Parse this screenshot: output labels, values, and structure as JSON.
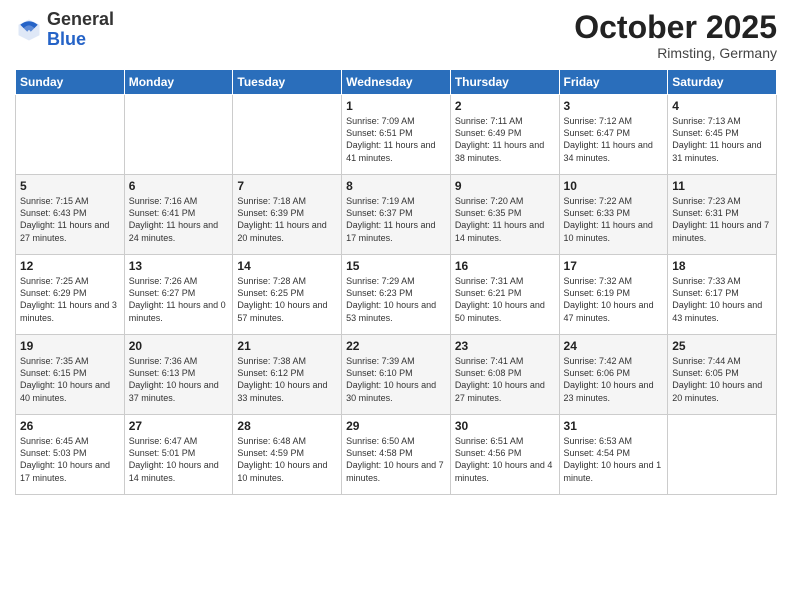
{
  "header": {
    "logo_general": "General",
    "logo_blue": "Blue",
    "month": "October 2025",
    "location": "Rimsting, Germany"
  },
  "days_of_week": [
    "Sunday",
    "Monday",
    "Tuesday",
    "Wednesday",
    "Thursday",
    "Friday",
    "Saturday"
  ],
  "weeks": [
    [
      {
        "day": "",
        "info": ""
      },
      {
        "day": "",
        "info": ""
      },
      {
        "day": "",
        "info": ""
      },
      {
        "day": "1",
        "info": "Sunrise: 7:09 AM\nSunset: 6:51 PM\nDaylight: 11 hours\nand 41 minutes."
      },
      {
        "day": "2",
        "info": "Sunrise: 7:11 AM\nSunset: 6:49 PM\nDaylight: 11 hours\nand 38 minutes."
      },
      {
        "day": "3",
        "info": "Sunrise: 7:12 AM\nSunset: 6:47 PM\nDaylight: 11 hours\nand 34 minutes."
      },
      {
        "day": "4",
        "info": "Sunrise: 7:13 AM\nSunset: 6:45 PM\nDaylight: 11 hours\nand 31 minutes."
      }
    ],
    [
      {
        "day": "5",
        "info": "Sunrise: 7:15 AM\nSunset: 6:43 PM\nDaylight: 11 hours\nand 27 minutes."
      },
      {
        "day": "6",
        "info": "Sunrise: 7:16 AM\nSunset: 6:41 PM\nDaylight: 11 hours\nand 24 minutes."
      },
      {
        "day": "7",
        "info": "Sunrise: 7:18 AM\nSunset: 6:39 PM\nDaylight: 11 hours\nand 20 minutes."
      },
      {
        "day": "8",
        "info": "Sunrise: 7:19 AM\nSunset: 6:37 PM\nDaylight: 11 hours\nand 17 minutes."
      },
      {
        "day": "9",
        "info": "Sunrise: 7:20 AM\nSunset: 6:35 PM\nDaylight: 11 hours\nand 14 minutes."
      },
      {
        "day": "10",
        "info": "Sunrise: 7:22 AM\nSunset: 6:33 PM\nDaylight: 11 hours\nand 10 minutes."
      },
      {
        "day": "11",
        "info": "Sunrise: 7:23 AM\nSunset: 6:31 PM\nDaylight: 11 hours\nand 7 minutes."
      }
    ],
    [
      {
        "day": "12",
        "info": "Sunrise: 7:25 AM\nSunset: 6:29 PM\nDaylight: 11 hours\nand 3 minutes."
      },
      {
        "day": "13",
        "info": "Sunrise: 7:26 AM\nSunset: 6:27 PM\nDaylight: 11 hours\nand 0 minutes."
      },
      {
        "day": "14",
        "info": "Sunrise: 7:28 AM\nSunset: 6:25 PM\nDaylight: 10 hours\nand 57 minutes."
      },
      {
        "day": "15",
        "info": "Sunrise: 7:29 AM\nSunset: 6:23 PM\nDaylight: 10 hours\nand 53 minutes."
      },
      {
        "day": "16",
        "info": "Sunrise: 7:31 AM\nSunset: 6:21 PM\nDaylight: 10 hours\nand 50 minutes."
      },
      {
        "day": "17",
        "info": "Sunrise: 7:32 AM\nSunset: 6:19 PM\nDaylight: 10 hours\nand 47 minutes."
      },
      {
        "day": "18",
        "info": "Sunrise: 7:33 AM\nSunset: 6:17 PM\nDaylight: 10 hours\nand 43 minutes."
      }
    ],
    [
      {
        "day": "19",
        "info": "Sunrise: 7:35 AM\nSunset: 6:15 PM\nDaylight: 10 hours\nand 40 minutes."
      },
      {
        "day": "20",
        "info": "Sunrise: 7:36 AM\nSunset: 6:13 PM\nDaylight: 10 hours\nand 37 minutes."
      },
      {
        "day": "21",
        "info": "Sunrise: 7:38 AM\nSunset: 6:12 PM\nDaylight: 10 hours\nand 33 minutes."
      },
      {
        "day": "22",
        "info": "Sunrise: 7:39 AM\nSunset: 6:10 PM\nDaylight: 10 hours\nand 30 minutes."
      },
      {
        "day": "23",
        "info": "Sunrise: 7:41 AM\nSunset: 6:08 PM\nDaylight: 10 hours\nand 27 minutes."
      },
      {
        "day": "24",
        "info": "Sunrise: 7:42 AM\nSunset: 6:06 PM\nDaylight: 10 hours\nand 23 minutes."
      },
      {
        "day": "25",
        "info": "Sunrise: 7:44 AM\nSunset: 6:05 PM\nDaylight: 10 hours\nand 20 minutes."
      }
    ],
    [
      {
        "day": "26",
        "info": "Sunrise: 6:45 AM\nSunset: 5:03 PM\nDaylight: 10 hours\nand 17 minutes."
      },
      {
        "day": "27",
        "info": "Sunrise: 6:47 AM\nSunset: 5:01 PM\nDaylight: 10 hours\nand 14 minutes."
      },
      {
        "day": "28",
        "info": "Sunrise: 6:48 AM\nSunset: 4:59 PM\nDaylight: 10 hours\nand 10 minutes."
      },
      {
        "day": "29",
        "info": "Sunrise: 6:50 AM\nSunset: 4:58 PM\nDaylight: 10 hours\nand 7 minutes."
      },
      {
        "day": "30",
        "info": "Sunrise: 6:51 AM\nSunset: 4:56 PM\nDaylight: 10 hours\nand 4 minutes."
      },
      {
        "day": "31",
        "info": "Sunrise: 6:53 AM\nSunset: 4:54 PM\nDaylight: 10 hours\nand 1 minute."
      },
      {
        "day": "",
        "info": ""
      }
    ]
  ]
}
